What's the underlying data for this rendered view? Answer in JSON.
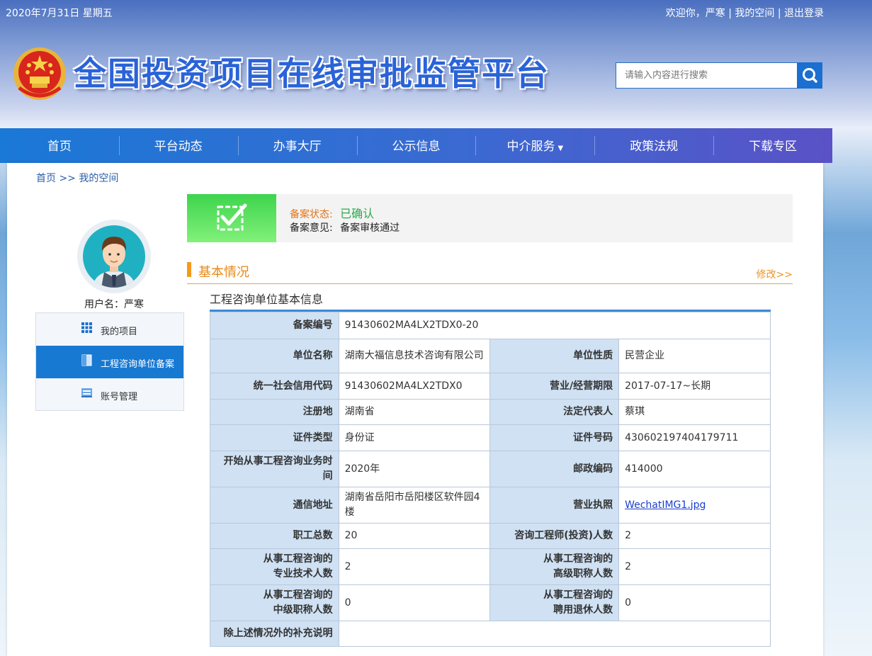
{
  "topbar": {
    "date": "2020年7月31日 星期五",
    "welcome": "欢迎你，严寒",
    "my_space": "我的空间",
    "logout": "退出登录",
    "sep": "|"
  },
  "header": {
    "site_title": "全国投资项目在线审批监管平台",
    "search_placeholder": "请输入内容进行搜索"
  },
  "nav": [
    "首页",
    "平台动态",
    "办事大厅",
    "公示信息",
    "中介服务",
    "政策法规",
    "下载专区"
  ],
  "nav_caret": "▼",
  "breadcrumb": {
    "home": "首页",
    "sep": ">>",
    "current": "我的空间"
  },
  "user": {
    "username": "用户名：严寒"
  },
  "menu": [
    {
      "label": "我的项目",
      "icon": "grid-icon"
    },
    {
      "label": "工程咨询单位备案",
      "icon": "document-icon",
      "active": true
    },
    {
      "label": "账号管理",
      "icon": "id-card-icon"
    }
  ],
  "status": {
    "state_label": "备案状态:",
    "state_value": "已确认",
    "opinion_label": "备案意见:",
    "opinion_value": "备案审核通过"
  },
  "section": {
    "title": "基本情况",
    "edit": "修改>>"
  },
  "subtitle": "工程咨询单位基本信息",
  "table": {
    "r0": {
      "k": "备案编号",
      "v": "91430602MA4LX2TDX0-20"
    },
    "r1": {
      "k1": "单位名称",
      "v1": "湖南大福信息技术咨询有限公司",
      "k2": "单位性质",
      "v2": "民营企业"
    },
    "r2": {
      "k1": "统一社会信用代码",
      "v1": "91430602MA4LX2TDX0",
      "k2": "营业/经营期限",
      "v2": "2017-07-17~长期"
    },
    "r3": {
      "k1": "注册地",
      "v1": "湖南省",
      "k2": "法定代表人",
      "v2": "蔡琪"
    },
    "r4": {
      "k1": "证件类型",
      "v1": "身份证",
      "k2": "证件号码",
      "v2": "430602197404179711"
    },
    "r5": {
      "k1": "开始从事工程咨询业务时间",
      "v1": "2020年",
      "k2": "邮政编码",
      "v2": "414000"
    },
    "r6": {
      "k1": "通信地址",
      "v1": "湖南省岳阳市岳阳楼区软件园4楼",
      "k2": "营业执照",
      "v2": "WechatIMG1.jpg"
    },
    "r7": {
      "k1": "职工总数",
      "v1": "20",
      "k2": "咨询工程师(投资)人数",
      "v2": "2"
    },
    "r8": {
      "k1a": "从事工程咨询的",
      "k1b": "专业技术人数",
      "v1": "2",
      "k2a": "从事工程咨询的",
      "k2b": "高级职称人数",
      "v2": "2"
    },
    "r9": {
      "k1a": "从事工程咨询的",
      "k1b": "中级职称人数",
      "v1": "0",
      "k2a": "从事工程咨询的",
      "k2b": "聘用退休人数",
      "v2": "0"
    },
    "r10": {
      "k": "除上述情况外的补充说明",
      "v": ""
    }
  },
  "colors": {
    "nav_start": "#1a78d6",
    "nav_end": "#5a52c6",
    "accent_orange": "#f39a1c",
    "status_green": "#2ea84b",
    "active_menu": "#1879d3"
  }
}
